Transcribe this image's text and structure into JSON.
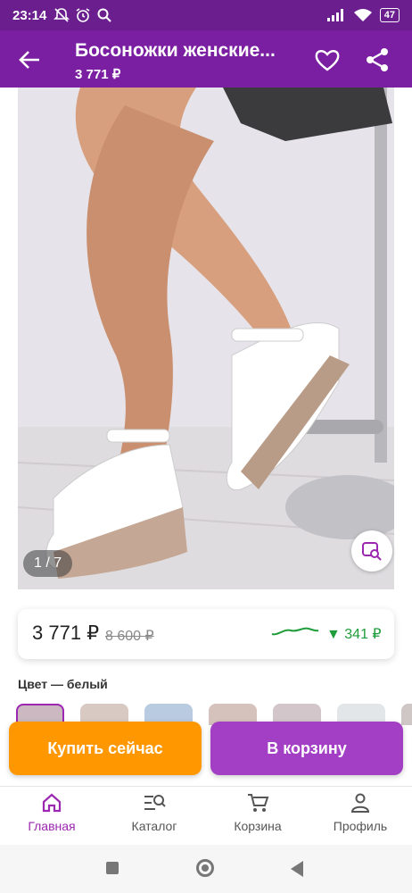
{
  "status_bar": {
    "time": "23:14",
    "battery": "47"
  },
  "app_bar": {
    "title": "Босоножки женские...",
    "price": "3 771 ₽"
  },
  "gallery": {
    "counter": "1 / 7"
  },
  "price_card": {
    "price": "3 771 ₽",
    "old_price": "8 600 ₽",
    "price_drop": "▼ 341 ₽"
  },
  "color": {
    "label": "Цвет — белый"
  },
  "actions": {
    "buy_now": "Купить сейчас",
    "add_to_cart": "В корзину"
  },
  "bottom_nav": {
    "items": [
      {
        "label": "Главная",
        "icon": "home-icon",
        "active": true
      },
      {
        "label": "Каталог",
        "icon": "catalog-search-icon",
        "active": false
      },
      {
        "label": "Корзина",
        "icon": "cart-icon",
        "active": false
      },
      {
        "label": "Профиль",
        "icon": "profile-icon",
        "active": false
      }
    ]
  },
  "colors": {
    "primary": "#7b1fa2",
    "status_bar": "#6b1f8f",
    "buy_button": "#ff9800",
    "cart_button": "#a33fc4",
    "price_drop": "#1f9d3a"
  }
}
